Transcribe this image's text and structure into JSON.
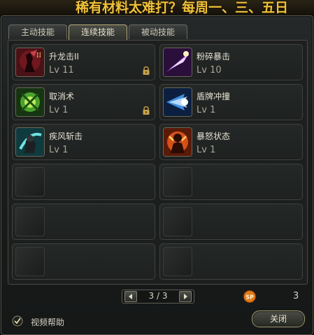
{
  "banner": {
    "text": "稀有材料太难打？每周一、三、五日"
  },
  "tabs": [
    {
      "label": "主动技能",
      "active": false
    },
    {
      "label": "连续技能",
      "active": true
    },
    {
      "label": "被动技能",
      "active": false
    }
  ],
  "skills": [
    {
      "name": "升龙击II",
      "level": "Lv 11",
      "locked": true,
      "icon": "rising-dragon-icon"
    },
    {
      "name": "粉碎暴击",
      "level": "Lv 10",
      "locked": false,
      "icon": "crush-strike-icon"
    },
    {
      "name": "取消术",
      "level": "Lv 1",
      "locked": true,
      "icon": "cancel-icon"
    },
    {
      "name": "盾牌冲撞",
      "level": "Lv 1",
      "locked": false,
      "icon": "shield-charge-icon"
    },
    {
      "name": "疾风斩击",
      "level": "Lv 1",
      "locked": false,
      "icon": "gale-slash-icon"
    },
    {
      "name": "暴怒状态",
      "level": "Lv 1",
      "locked": false,
      "icon": "rage-icon"
    }
  ],
  "empty_slots": 6,
  "pager": {
    "label": "3 / 3"
  },
  "sp": {
    "icon_text": "SP",
    "value": "3"
  },
  "help": {
    "label": "视频帮助",
    "checked": true
  },
  "close_button": {
    "label": "关闭"
  },
  "colors": {
    "accent_gold": "#f0c23a",
    "panel_bg": "#1c1f1e"
  }
}
